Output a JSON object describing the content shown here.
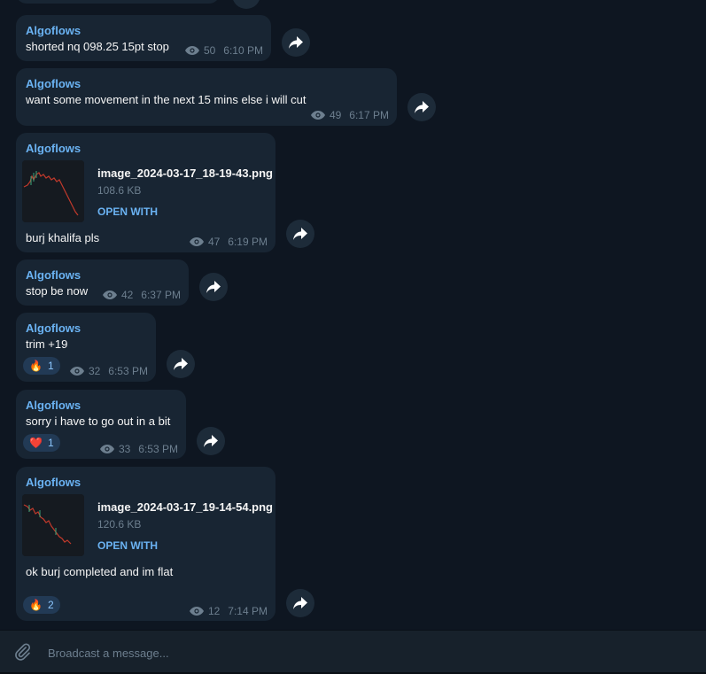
{
  "channel": {
    "accent_color": "#6ab2f2",
    "bubble_color": "#182533",
    "background_color": "#0e1621"
  },
  "messages": [
    {
      "author": "Algoflows",
      "text": "shorted nq 098.25 15pt stop",
      "views": "50",
      "time": "6:10 PM"
    },
    {
      "author": "Algoflows",
      "text": "want some movement in the next 15 mins else i will cut",
      "views": "49",
      "time": "6:17 PM"
    },
    {
      "author": "Algoflows",
      "file_name": "image_2024-03-17_18-19-43.png",
      "file_size": "108.6 KB",
      "open_with": "OPEN WITH",
      "text": "burj khalifa pls",
      "views": "47",
      "time": "6:19 PM"
    },
    {
      "author": "Algoflows",
      "text": "stop be now",
      "views": "42",
      "time": "6:37 PM"
    },
    {
      "author": "Algoflows",
      "text": "trim +19",
      "reaction_emoji": "🔥",
      "reaction_count": "1",
      "views": "32",
      "time": "6:53 PM"
    },
    {
      "author": "Algoflows",
      "text": "sorry i have to go out in a bit",
      "reaction_emoji": "❤️",
      "reaction_count": "1",
      "views": "33",
      "time": "6:53 PM"
    },
    {
      "author": "Algoflows",
      "file_name": "image_2024-03-17_19-14-54.png",
      "file_size": "120.6 KB",
      "open_with": "OPEN WITH",
      "text": "ok burj completed and im flat",
      "reaction_emoji": "🔥",
      "reaction_count": "2",
      "views": "12",
      "time": "7:14 PM"
    }
  ],
  "composer": {
    "placeholder": "Broadcast a message...",
    "value": ""
  },
  "icons": {
    "attach": "paperclip-icon",
    "forward": "forward-arrow-icon",
    "views": "eye-icon"
  }
}
